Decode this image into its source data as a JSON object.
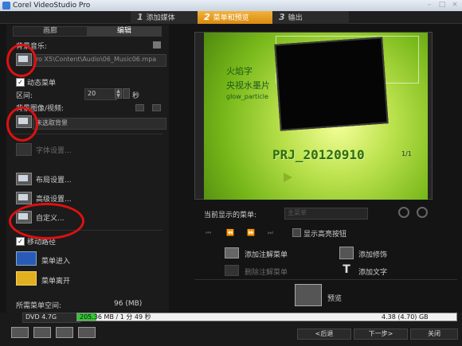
{
  "app": {
    "title": "Corel VideoStudio Pro"
  },
  "steps": [
    {
      "num": "1",
      "label": "添加媒体"
    },
    {
      "num": "2",
      "label": "菜单和预览"
    },
    {
      "num": "3",
      "label": "输出"
    }
  ],
  "tabs": {
    "gallery": "画廊",
    "edit": "编辑"
  },
  "left": {
    "bg_music_label": "背景音乐:",
    "bg_music_path": "ro X5\\Content\\Audio\\06_Music06.mpa",
    "motion_menu_label": "动态菜单",
    "interval_label": "区间:",
    "interval_value": "20",
    "seconds_label": "秒",
    "bg_image_label": "背景图像/视频:",
    "bg_image_value": "未选取背景",
    "font_settings": "字体设置...",
    "layout_settings": "布局设置...",
    "advanced_settings": "高级设置...",
    "custom": "自定义...",
    "motion_path": "移动路径",
    "menu_enter": "菜单进入",
    "menu_leave": "菜单离开",
    "space_label": "所需菜单空间:",
    "space_value": "96 (MB)"
  },
  "preview": {
    "line1": "火焰字",
    "line2": "央视水墨片",
    "line3": "glow_particle",
    "project": "PRJ_20120910",
    "page": "1/1",
    "current_menu_label": "当前显示的菜单:",
    "current_menu_value": "主菜单",
    "show_highlight": "显示高亮按钮"
  },
  "actions": {
    "add_note": "添加注解菜单",
    "delete_note": "删除注解菜单",
    "add_decoration": "添加修饰",
    "add_text": "添加文字",
    "preview": "预览"
  },
  "bottom": {
    "disc": "DVD 4.7G",
    "used": "205.36 MB / 1 分 49 秒",
    "total": "4.38 (4.70) GB",
    "used_fraction": 0.05,
    "back": "<后退",
    "next": "下一步>",
    "close": "关闭"
  }
}
